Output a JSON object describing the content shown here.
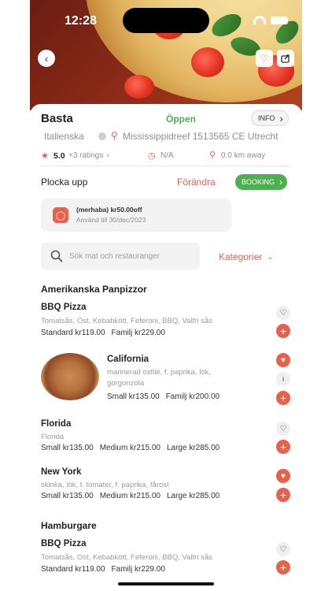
{
  "status": {
    "time": "12:28"
  },
  "restaurant": {
    "name": "Basta",
    "status": "Öppen",
    "info_label": "INFO",
    "cuisine": "Italienska",
    "address": "Mississippidreef 1513565 CE Utrecht",
    "rating": "5.0",
    "rating_count": "+3 ratings",
    "price_info": "N/A",
    "distance": "0.0 km away"
  },
  "pickup": {
    "mode": "Plocka upp",
    "change_label": "Förändra",
    "booking_label": "BOOKING"
  },
  "coupon": {
    "title": "(merhaba) kr50.00off",
    "subtitle": "Använd till 30/dec/2023"
  },
  "search": {
    "placeholder": "Sök mat och restauranger",
    "categories_label": "Kategorier"
  },
  "sections": [
    {
      "title": "Amerikanska Panpizzor",
      "items": [
        {
          "name": "BBQ Pizza",
          "desc": "Tomatsås, Ost, Kebabkött, Feferoni, BBQ, Valfri sås",
          "prices": [
            "Standard kr119.00",
            "Familj kr229.00"
          ],
          "favorite": false
        },
        {
          "name": "California",
          "desc1": "marinerad oxfilé, f. paprika, lök,",
          "desc2": "gorgonzola",
          "prices": [
            "Small kr135.00",
            "Familj kr200.00"
          ],
          "favorite": true
        },
        {
          "name": "Florida",
          "desc": "Florida",
          "prices": [
            "Small kr135.00",
            "Medium kr215.00",
            "Large kr285.00"
          ],
          "favorite": false
        },
        {
          "name": "New York",
          "desc": "skinka, lök, f. tomater, f. paprika, fårost",
          "prices": [
            "Small kr135.00",
            "Medium kr215.00",
            "Large kr285.00"
          ],
          "favorite": true
        }
      ]
    },
    {
      "title": "Hamburgare",
      "items": [
        {
          "name": "BBQ Pizza",
          "desc": "Tomatsås, Ost, Kebabkött, Feferoni, BBQ, Valfri sås",
          "prices": [
            "Standard kr119.00",
            "Familj kr229.00"
          ],
          "favorite": false
        }
      ]
    }
  ],
  "icons": {
    "back": "chevron-left-icon",
    "favorite": "heart-icon",
    "share": "share-icon",
    "star": "star-icon",
    "clock": "clock-icon",
    "location": "location-pin-icon",
    "search": "search-icon",
    "add": "plus-icon",
    "info": "info-icon"
  },
  "colors": {
    "accent": "#e8614a",
    "success": "#4caf50"
  }
}
